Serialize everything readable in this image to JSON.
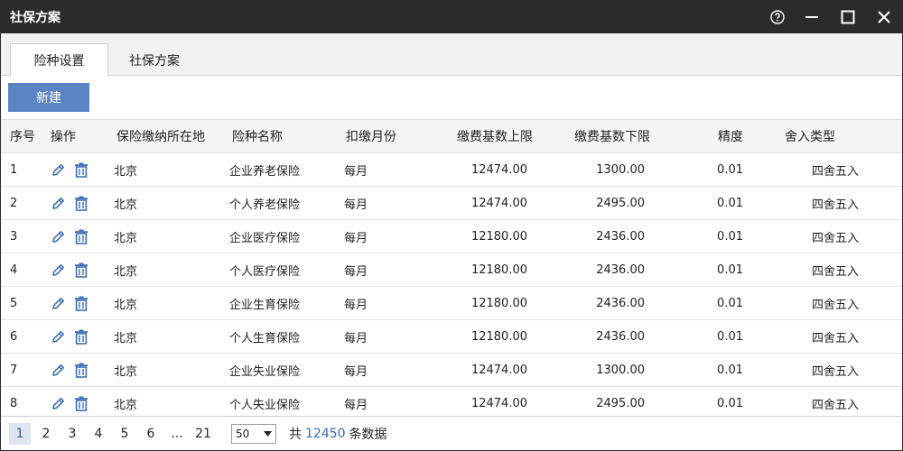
{
  "window": {
    "title": "社保方案"
  },
  "tabs": [
    {
      "label": "险种设置"
    },
    {
      "label": "社保方案"
    }
  ],
  "toolbar": {
    "new_label": "新建"
  },
  "table": {
    "columns": [
      "序号",
      "操作",
      "保险缴纳所在地",
      "险种名称",
      "扣缴月份",
      "缴费基数上限",
      "缴费基数下限",
      "精度",
      "舍入类型"
    ],
    "rows": [
      {
        "idx": "1",
        "location": "北京",
        "name": "企业养老保险",
        "month": "每月",
        "upper": "12474.00",
        "lower": "1300.00",
        "precision": "0.01",
        "rounding": "四舍五入"
      },
      {
        "idx": "2",
        "location": "北京",
        "name": "个人养老保险",
        "month": "每月",
        "upper": "12474.00",
        "lower": "2495.00",
        "precision": "0.01",
        "rounding": "四舍五入"
      },
      {
        "idx": "3",
        "location": "北京",
        "name": "企业医疗保险",
        "month": "每月",
        "upper": "12180.00",
        "lower": "2436.00",
        "precision": "0.01",
        "rounding": "四舍五入"
      },
      {
        "idx": "4",
        "location": "北京",
        "name": "个人医疗保险",
        "month": "每月",
        "upper": "12180.00",
        "lower": "2436.00",
        "precision": "0.01",
        "rounding": "四舍五入"
      },
      {
        "idx": "5",
        "location": "北京",
        "name": "企业生育保险",
        "month": "每月",
        "upper": "12180.00",
        "lower": "2436.00",
        "precision": "0.01",
        "rounding": "四舍五入"
      },
      {
        "idx": "6",
        "location": "北京",
        "name": "个人生育保险",
        "month": "每月",
        "upper": "12180.00",
        "lower": "2436.00",
        "precision": "0.01",
        "rounding": "四舍五入"
      },
      {
        "idx": "7",
        "location": "北京",
        "name": "企业失业保险",
        "month": "每月",
        "upper": "12474.00",
        "lower": "1300.00",
        "precision": "0.01",
        "rounding": "四舍五入"
      },
      {
        "idx": "8",
        "location": "北京",
        "name": "个人失业保险",
        "month": "每月",
        "upper": "12474.00",
        "lower": "2495.00",
        "precision": "0.01",
        "rounding": "四舍五入"
      }
    ]
  },
  "pagination": {
    "pages": [
      "1",
      "2",
      "3",
      "4",
      "5",
      "6",
      "...",
      "21"
    ],
    "current": "1",
    "page_size": "50",
    "total_prefix": "共",
    "total_count": "12450",
    "total_suffix": "条数据"
  },
  "icons": {
    "help": "help-circle-icon",
    "minimize": "minimize-icon",
    "maximize": "maximize-icon",
    "close": "close-icon",
    "edit": "pencil-icon",
    "delete": "trash-icon",
    "dropdown": "caret-down-icon"
  },
  "colors": {
    "titlebar": "#2b2b2b",
    "primary_button": "#5b84c4",
    "link": "#3a66b5",
    "icon": "#3f6fb5"
  }
}
